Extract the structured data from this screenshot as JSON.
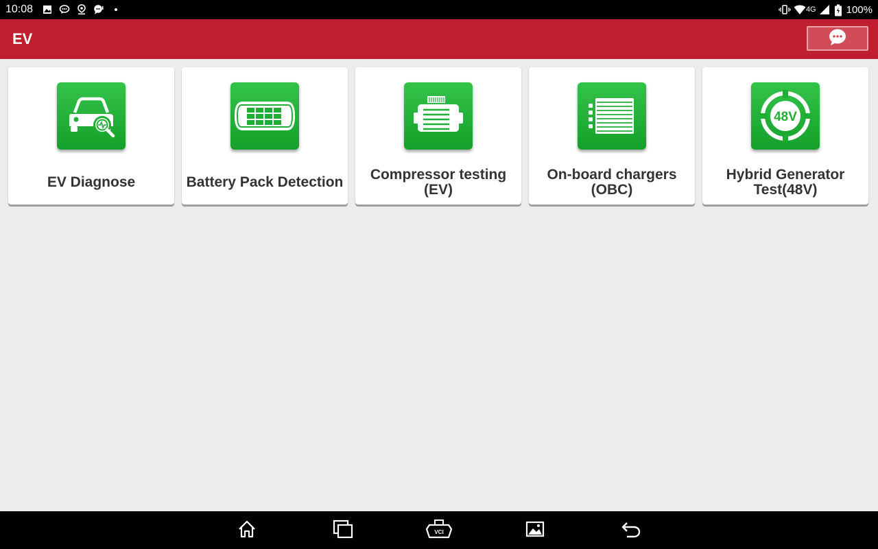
{
  "status_bar": {
    "time": "10:08",
    "network": "4G",
    "battery": "100%",
    "left_icons": [
      "image-icon",
      "message-icon",
      "location-icon",
      "chat-notification-icon",
      "dot-icon"
    ],
    "right_icons": [
      "vibrate-icon",
      "wifi-icon",
      "signal-icon",
      "battery-icon"
    ]
  },
  "app_bar": {
    "title": "EV",
    "chat_button_icon": "chat-bubble-icon"
  },
  "cards": [
    {
      "label": "EV Diagnose",
      "icon": "ev-diagnose-icon"
    },
    {
      "label": "Battery Pack Detection",
      "icon": "battery-pack-icon"
    },
    {
      "label": "Compressor testing (EV)",
      "icon": "compressor-icon"
    },
    {
      "label": "On-board chargers (OBC)",
      "icon": "charger-icon"
    },
    {
      "label": "Hybrid Generator Test(48V)",
      "icon": "hybrid-48v-icon",
      "badge": "48V"
    }
  ],
  "nav_bar": {
    "buttons": [
      "home-icon",
      "recent-apps-icon",
      "vci-icon",
      "screenshot-icon",
      "back-icon"
    ],
    "vci_label": "VCI"
  },
  "colors": {
    "app_bar": "#be1e2d",
    "icon_green": "#1fae34",
    "background": "#ececec"
  }
}
